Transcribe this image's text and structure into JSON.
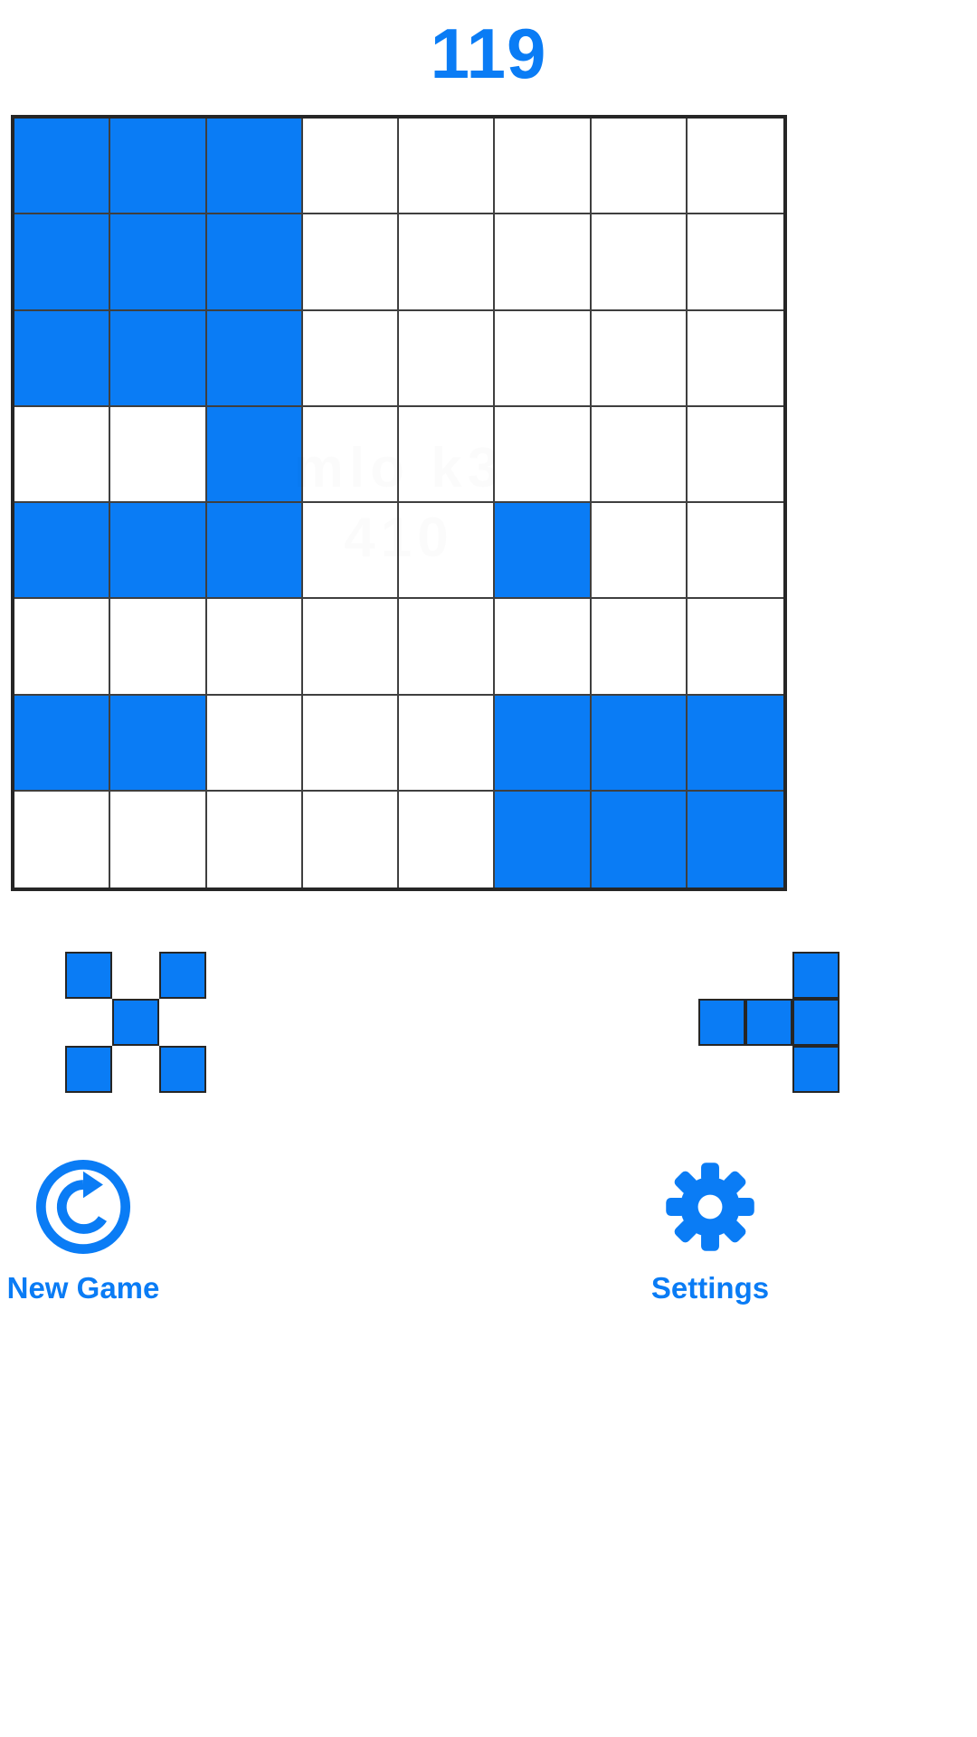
{
  "app": {
    "accent_color": "#0a7cf5",
    "grid_line_color": "#333333",
    "background_color": "#ffffff"
  },
  "header": {
    "score": "119"
  },
  "board": {
    "rows": 8,
    "cols": 8,
    "filled_color": "#0a7cf5",
    "empty_color": "#ffffff",
    "watermark_line1": "mlo k3",
    "watermark_line2": "410",
    "cells": [
      [
        1,
        1,
        1,
        0,
        0,
        0,
        0,
        0
      ],
      [
        1,
        1,
        1,
        0,
        0,
        0,
        0,
        0
      ],
      [
        1,
        1,
        1,
        0,
        0,
        0,
        0,
        0
      ],
      [
        0,
        0,
        1,
        0,
        0,
        0,
        0,
        0
      ],
      [
        1,
        1,
        1,
        0,
        0,
        1,
        0,
        0
      ],
      [
        0,
        0,
        0,
        0,
        0,
        0,
        0,
        0
      ],
      [
        1,
        1,
        0,
        0,
        0,
        1,
        1,
        1
      ],
      [
        0,
        0,
        0,
        0,
        0,
        1,
        1,
        1
      ]
    ]
  },
  "tray": {
    "pieces": [
      {
        "name": "x-corners-piece",
        "cells": [
          [
            1,
            0,
            1
          ],
          [
            0,
            1,
            0
          ],
          [
            1,
            0,
            1
          ]
        ]
      },
      {
        "name": "empty-slot",
        "cells": [
          [
            0,
            0,
            0
          ],
          [
            0,
            0,
            0
          ],
          [
            0,
            0,
            0
          ]
        ]
      },
      {
        "name": "t-right-piece",
        "cells": [
          [
            0,
            0,
            1
          ],
          [
            1,
            1,
            1
          ],
          [
            0,
            0,
            1
          ]
        ]
      }
    ]
  },
  "actions": {
    "new_game": {
      "label": "New Game",
      "icon": "refresh-circle-icon"
    },
    "settings": {
      "label": "Settings",
      "icon": "gear-icon"
    }
  }
}
